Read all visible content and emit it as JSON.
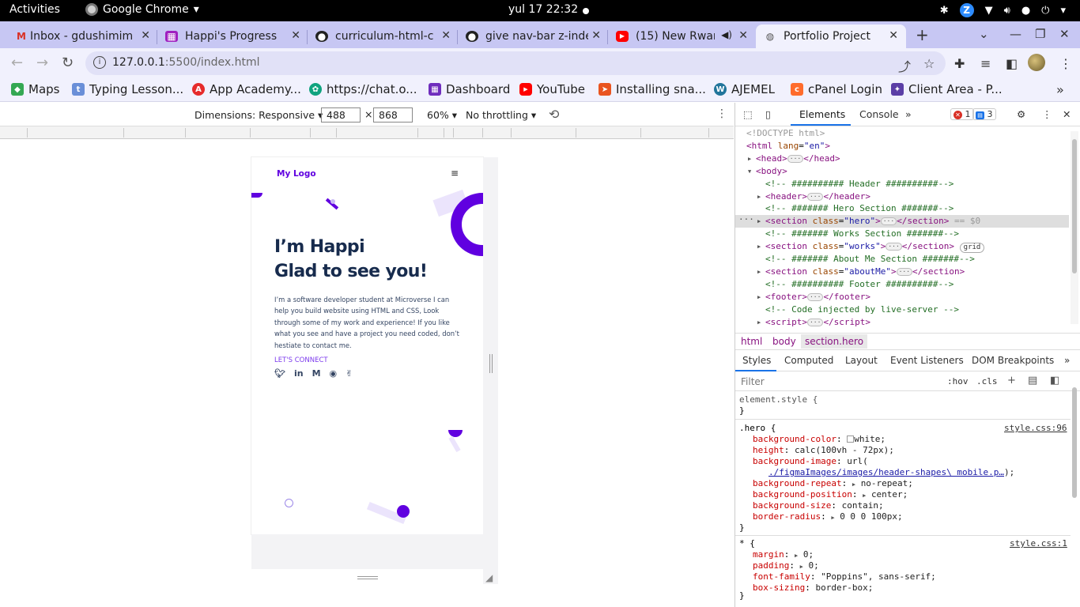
{
  "os": {
    "activities": "Activities",
    "app_name": "Google Chrome",
    "clock": "yul 17  22:32"
  },
  "browser": {
    "tabs": [
      {
        "title": "Inbox - gdushimim",
        "favicon": "gmail-icon"
      },
      {
        "title": "Happi's Progress",
        "favicon": "app-academy-icon"
      },
      {
        "title": "curriculum-html-c",
        "favicon": "github-icon"
      },
      {
        "title": "give nav-bar z-inde",
        "favicon": "github-icon"
      },
      {
        "title": "(15) New Rwan",
        "favicon": "youtube-icon"
      },
      {
        "title": "Portfolio Project",
        "favicon": "globe-icon"
      }
    ],
    "active_tab": 5,
    "url_host": "127.0.0.1",
    "url_path": ":5500/index.html",
    "bookmarks": [
      {
        "label": "Maps",
        "color": "#34a853"
      },
      {
        "label": "Typing Lesson...",
        "color": "#6a8fd8"
      },
      {
        "label": "App Academy...",
        "color": "#e62b2b"
      },
      {
        "label": "https://chat.o...",
        "color": "#10a37f"
      },
      {
        "label": "Dashboard",
        "color": "#6f2dbd"
      },
      {
        "label": "YouTube",
        "color": "#ff0000"
      },
      {
        "label": "Installing sna...",
        "color": "#e95420"
      },
      {
        "label": "AJEMEL",
        "color": "#21759b"
      },
      {
        "label": "cPanel Login",
        "color": "#ff6c2c"
      },
      {
        "label": "Client Area - P...",
        "color": "#5b3ea6"
      }
    ]
  },
  "device_toolbar": {
    "dimensions_label": "Dimensions: Responsive",
    "width": "488",
    "height": "868",
    "times": "×",
    "zoom": "60%",
    "throttling": "No throttling"
  },
  "page": {
    "logo": "My Logo",
    "menu_icon": "≡",
    "heading_line1": "I’m Happi",
    "heading_line2": "Glad to see you!",
    "intro": "I’m a software developer student at Microverse I can help you build website using HTML and CSS, Look through some of my work and experience! If you like what you see and have a project you need coded, don’t hestiate to contact me.",
    "connect": "LET'S CONNECT",
    "socials": [
      "twitter-icon",
      "linkedin-icon",
      "medium-icon",
      "github-icon",
      "angellist-icon"
    ],
    "accent_color": "#6000e0"
  },
  "devtools": {
    "tabs": [
      "Elements",
      "Console"
    ],
    "active_tab": "Elements",
    "errors": "1",
    "messages": "3",
    "dom": [
      {
        "indent": 0,
        "html": "<span class='dim-t'>&lt;!DOCTYPE html&gt;</span>"
      },
      {
        "indent": 0,
        "html": "<span class='tag'>&lt;html</span> <span class='attr'>lang</span>=<span class='val'>\"en\"</span><span class='tag'>&gt;</span>"
      },
      {
        "indent": 1,
        "arrow": "▶",
        "html": "<span class='tag'>&lt;head&gt;</span><span class='ell'>···</span><span class='tag'>&lt;/head&gt;</span>"
      },
      {
        "indent": 1,
        "arrow": "▼",
        "html": "<span class='tag'>&lt;body&gt;</span>"
      },
      {
        "indent": 2,
        "html": "<span class='com'>&lt;!-- ########## Header ##########--&gt;</span>"
      },
      {
        "indent": 2,
        "arrow": "▶",
        "html": "<span class='tag'>&lt;header&gt;</span><span class='ell'>···</span><span class='tag'>&lt;/header&gt;</span>"
      },
      {
        "indent": 2,
        "html": "<span class='com'>&lt;!-- ####### Hero Section #######--&gt;</span>"
      },
      {
        "indent": 2,
        "arrow": "▶",
        "sel": true,
        "html": "<span class='tag'>&lt;section</span> <span class='attr'>class</span>=<span class='val'>\"hero\"</span><span class='tag'>&gt;</span><span class='ell'>···</span><span class='tag'>&lt;/section&gt;</span> <span class='dim-t'>== $0</span>"
      },
      {
        "indent": 2,
        "html": "<span class='com'>&lt;!-- ####### Works Section #######--&gt;</span>"
      },
      {
        "indent": 2,
        "arrow": "▶",
        "html": "<span class='tag'>&lt;section</span> <span class='attr'>class</span>=<span class='val'>\"works\"</span><span class='tag'>&gt;</span><span class='ell'>···</span><span class='tag'>&lt;/section&gt;</span> <span class='gridbadge'>grid</span>"
      },
      {
        "indent": 2,
        "html": "<span class='com'>&lt;!-- ####### About Me Section #######--&gt;</span>"
      },
      {
        "indent": 2,
        "arrow": "▶",
        "html": "<span class='tag'>&lt;section</span> <span class='attr'>class</span>=<span class='val'>\"aboutMe\"</span><span class='tag'>&gt;</span><span class='ell'>···</span><span class='tag'>&lt;/section&gt;</span>"
      },
      {
        "indent": 2,
        "html": "<span class='com'>&lt;!-- ########## Footer ##########--&gt;</span>"
      },
      {
        "indent": 2,
        "arrow": "▶",
        "html": "<span class='tag'>&lt;footer&gt;</span><span class='ell'>···</span><span class='tag'>&lt;/footer&gt;</span>"
      },
      {
        "indent": 2,
        "html": "<span class='com'>&lt;!-- Code injected by live-server --&gt;</span>"
      },
      {
        "indent": 2,
        "arrow": "▶",
        "html": "<span class='tag'>&lt;script&gt;</span><span class='ell'>···</span><span class='tag'>&lt;/script&gt;</span>"
      }
    ],
    "breadcrumbs": [
      "html",
      "body",
      "section.hero"
    ],
    "subtabs": [
      "Styles",
      "Computed",
      "Layout",
      "Event Listeners",
      "DOM Breakpoints"
    ],
    "filter_placeholder": "Filter",
    "hov": ":hov",
    "cls": ".cls",
    "rules": {
      "element_style": "element.style {",
      "hero_selector": ".hero {",
      "hero_source": "style.css:96",
      "hero_props": [
        {
          "p": "background-color",
          "v": "white;",
          "swatch": true
        },
        {
          "p": "height",
          "v": "calc(100vh - 72px);"
        },
        {
          "p": "background-image",
          "v": "url("
        },
        {
          "url": "./figmaImages/images/header-shapes\\ mobile.p…",
          "tail": ");"
        },
        {
          "p": "background-repeat",
          "v": "no-repeat;",
          "tri": true
        },
        {
          "p": "background-position",
          "v": "center;",
          "tri": true
        },
        {
          "p": "background-size",
          "v": "contain;"
        },
        {
          "p": "border-radius",
          "v": "0 0 0 100px;",
          "tri": true
        }
      ],
      "star_selector": "* {",
      "star_source": "style.css:1",
      "star_props": [
        {
          "p": "margin",
          "v": "0;",
          "tri": true
        },
        {
          "p": "padding",
          "v": "0;",
          "tri": true
        },
        {
          "p": "font-family",
          "v": "\"Poppins\", sans-serif;"
        },
        {
          "p": "box-sizing",
          "v": "border-box;"
        }
      ]
    }
  }
}
